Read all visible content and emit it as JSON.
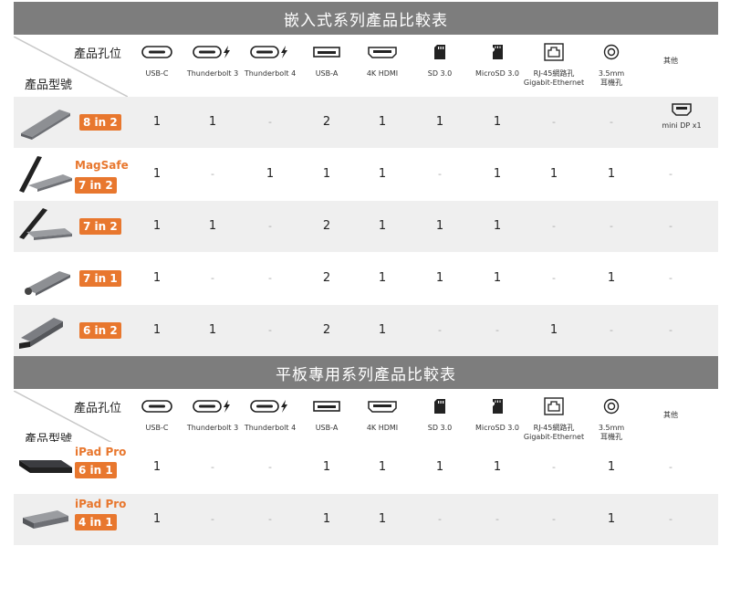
{
  "section1": {
    "title": "嵌入式系列產品比較表"
  },
  "section2": {
    "title": "平板專用系列產品比較表"
  },
  "header": {
    "port_label": "產品孔位",
    "model_label": "產品型號",
    "columns": [
      {
        "name": "USB-C",
        "icon": "usb-c-icon"
      },
      {
        "name": "Thunderbolt 3",
        "icon": "thunderbolt-3-icon"
      },
      {
        "name": "Thunderbolt 4",
        "icon": "thunderbolt-4-icon"
      },
      {
        "name": "USB-A",
        "icon": "usb-a-icon"
      },
      {
        "name": "4K HDMI",
        "icon": "hdmi-icon"
      },
      {
        "name": "SD 3.0",
        "icon": "sd-card-icon"
      },
      {
        "name": "MicroSD 3.0",
        "icon": "microsd-card-icon"
      },
      {
        "name": "RJ-45網路孔",
        "name2": "Gigabit-Ethernet",
        "icon": "ethernet-icon"
      },
      {
        "name": "3.5mm",
        "name2": "耳機孔",
        "icon": "audio-jack-icon"
      },
      {
        "name": "其他"
      }
    ]
  },
  "rows1": [
    {
      "badge": "8 in 2",
      "title": "",
      "values": [
        "1",
        "1",
        "-",
        "2",
        "1",
        "1",
        "1",
        "-",
        "-"
      ],
      "extra": "mini DP x1"
    },
    {
      "badge": "7 in 2",
      "title": "MagSafe",
      "values": [
        "1",
        "-",
        "1",
        "1",
        "1",
        "-",
        "1",
        "1",
        "1",
        "-"
      ]
    },
    {
      "badge": "7 in 2",
      "title": "",
      "values": [
        "1",
        "1",
        "-",
        "2",
        "1",
        "1",
        "1",
        "-",
        "-",
        "-"
      ]
    },
    {
      "badge": "7 in 1",
      "title": "",
      "values": [
        "1",
        "-",
        "-",
        "2",
        "1",
        "1",
        "1",
        "-",
        "1",
        "-"
      ]
    },
    {
      "badge": "6 in 2",
      "title": "",
      "values": [
        "1",
        "1",
        "-",
        "2",
        "1",
        "-",
        "-",
        "1",
        "-",
        "-"
      ]
    }
  ],
  "rows2": [
    {
      "badge": "6 in 1",
      "title": "iPad Pro",
      "values": [
        "1",
        "-",
        "-",
        "1",
        "1",
        "1",
        "1",
        "-",
        "1",
        "-"
      ]
    },
    {
      "badge": "4 in 1",
      "title": "iPad Pro",
      "values": [
        "1",
        "-",
        "-",
        "1",
        "1",
        "-",
        "-",
        "-",
        "1",
        "-"
      ]
    }
  ],
  "colors": {
    "accent": "#e8772e",
    "banner": "#7d7d7d",
    "stripe": "#efefef"
  }
}
